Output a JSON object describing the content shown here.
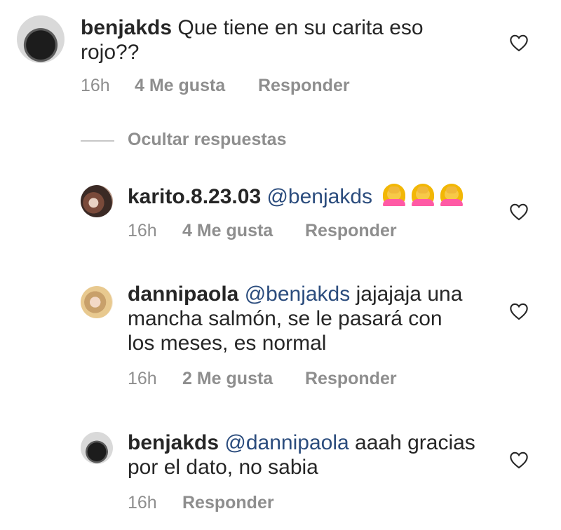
{
  "comments": [
    {
      "username": "benjakds",
      "mention": "",
      "text": "Que tiene en su carita eso",
      "text_line2": "rojo??",
      "time": "16h",
      "likes": "4 Me gusta",
      "reply_label": "Responder"
    },
    {
      "username": "karito.8.23.03",
      "mention": "@benjakds",
      "text": "",
      "emoji": [
        "woman-facepalming-emoji",
        "woman-facepalming-emoji",
        "woman-facepalming-emoji"
      ],
      "time": "16h",
      "likes": "4 Me gusta",
      "reply_label": "Responder"
    },
    {
      "username": "dannipaola",
      "mention": "@benjakds",
      "text": "jajajaja una",
      "text_line2": "mancha salmón, se le pasará con",
      "text_line3": "los meses, es normal",
      "time": "16h",
      "likes": "2 Me gusta",
      "reply_label": "Responder"
    },
    {
      "username": "benjakds",
      "mention": "@dannipaola",
      "text": "aaah gracias",
      "text_line2": "por el dato, no sabia",
      "time": "16h",
      "reply_label": "Responder"
    }
  ],
  "hide_replies_label": "Ocultar respuestas",
  "icons": {
    "like": "heart-outline-icon"
  },
  "colors": {
    "text": "#262626",
    "meta": "#8e8e8e",
    "mention": "#2b4c7d",
    "divider": "#c7c7c7"
  }
}
